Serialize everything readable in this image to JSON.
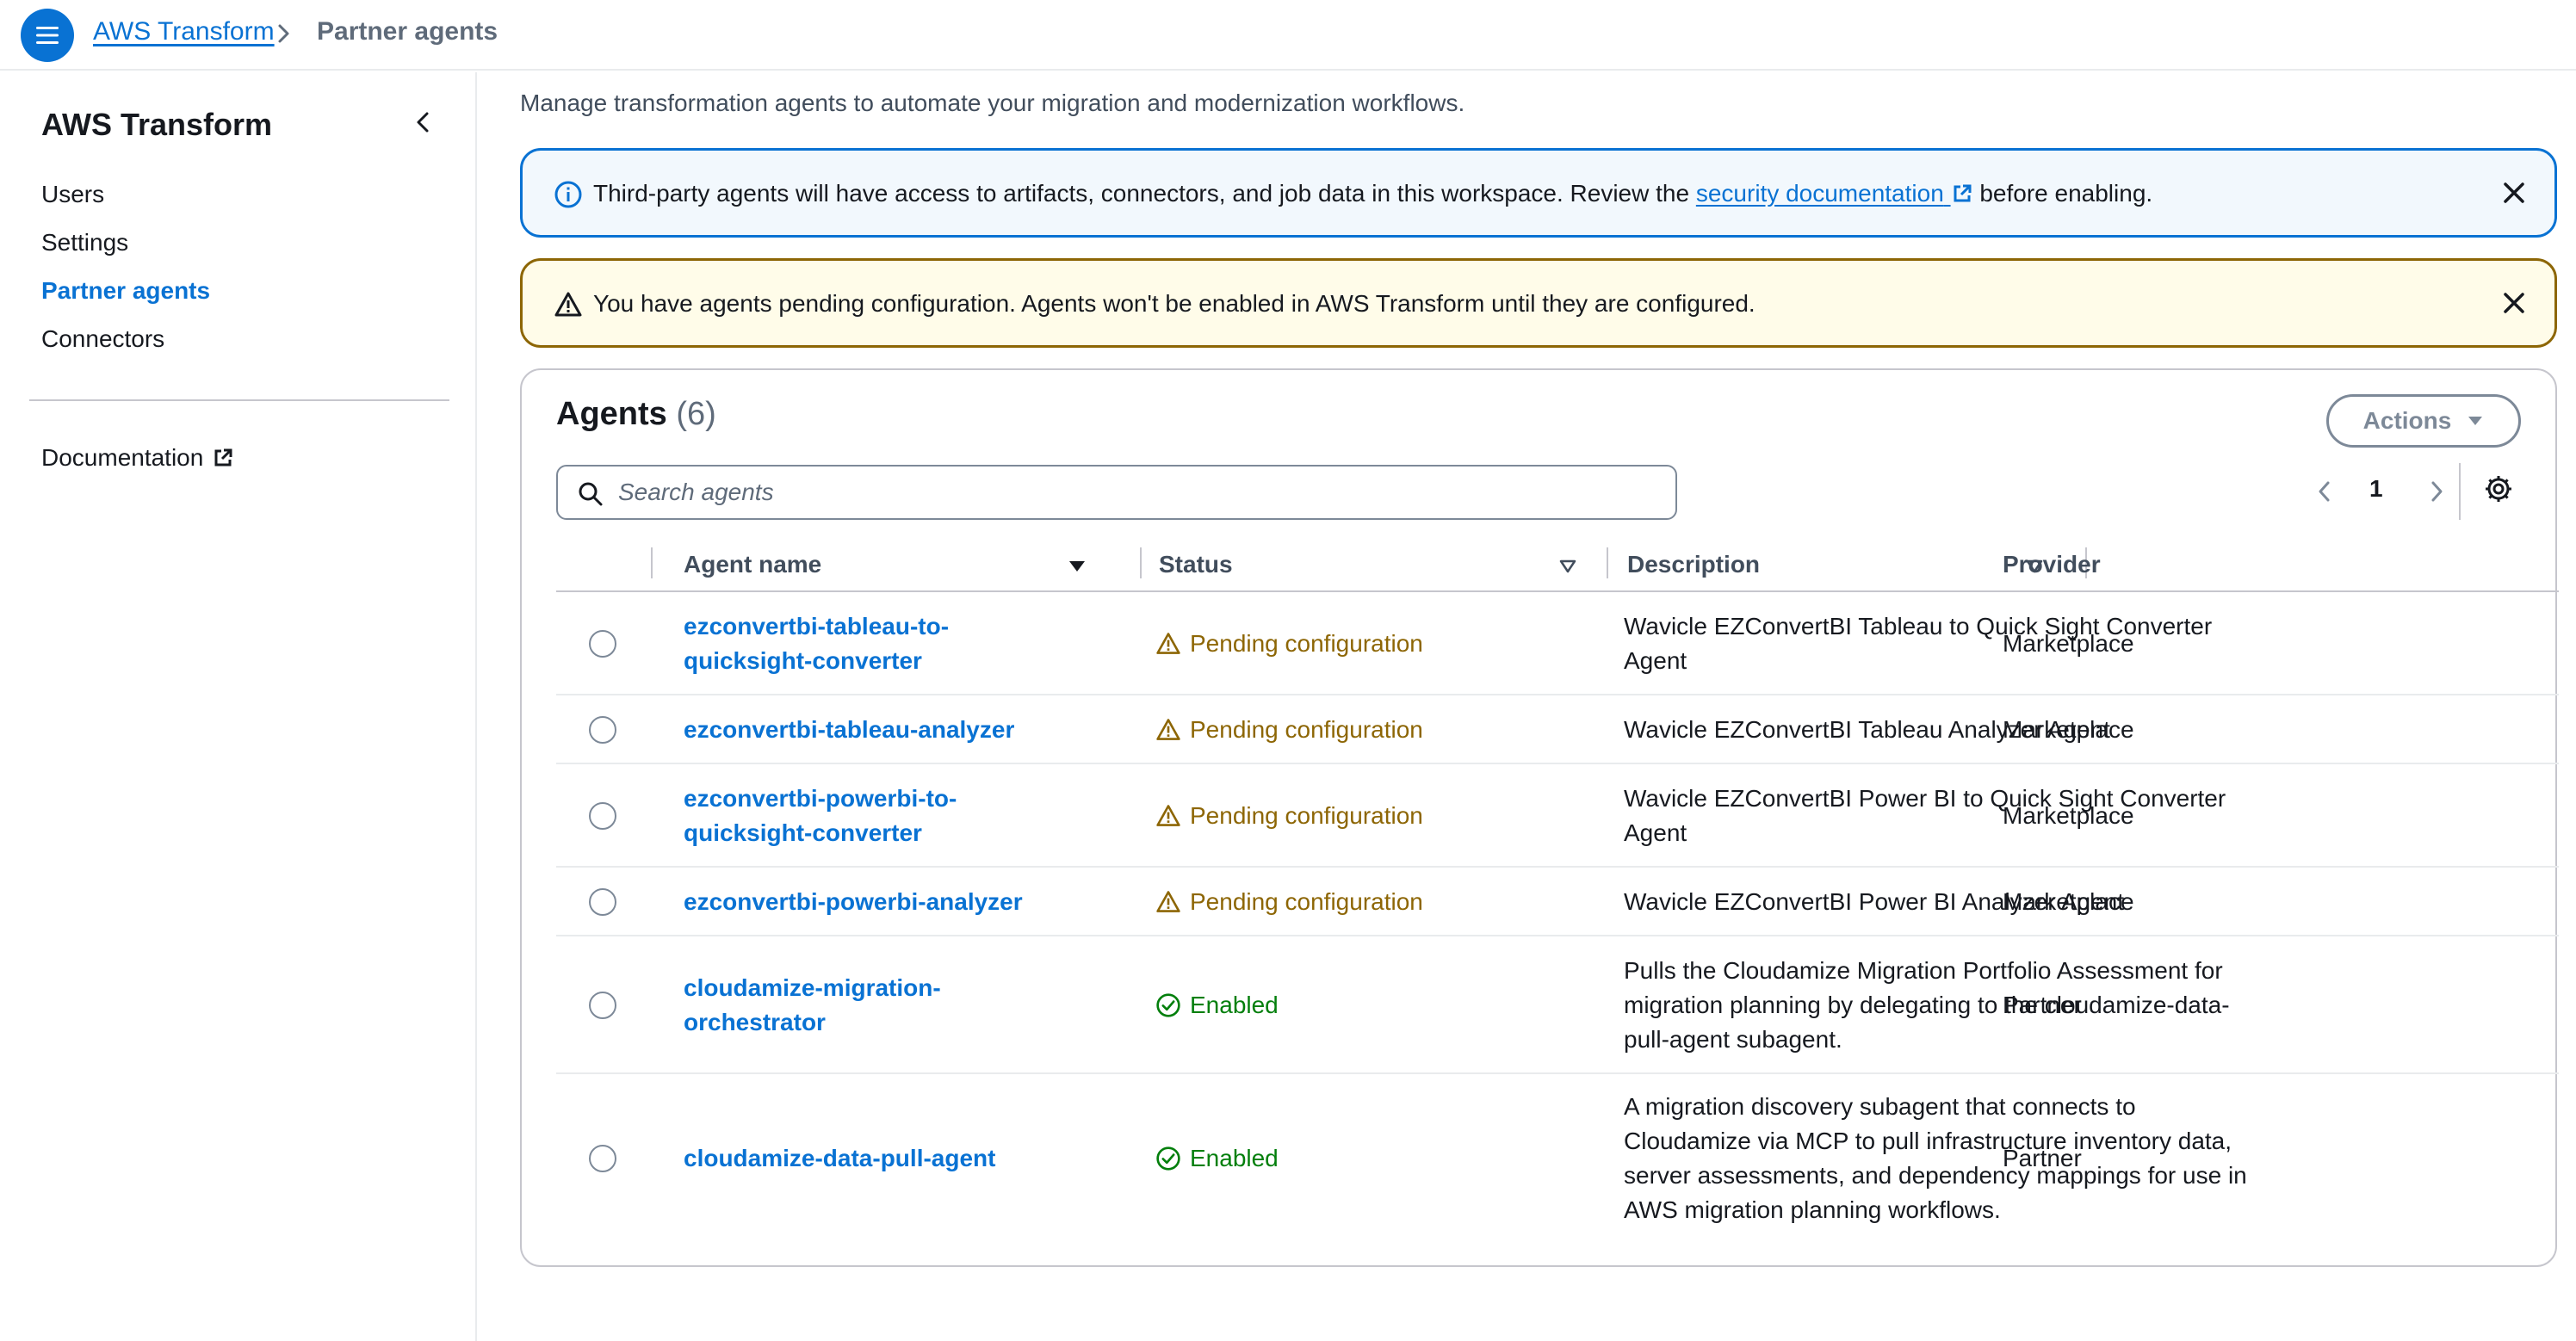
{
  "breadcrumb": {
    "root": "AWS Transform",
    "current": "Partner agents"
  },
  "sidebar": {
    "title": "AWS Transform",
    "items": [
      {
        "label": "Users"
      },
      {
        "label": "Settings"
      },
      {
        "label": "Partner agents"
      },
      {
        "label": "Connectors"
      }
    ],
    "documentation": "Documentation"
  },
  "main": {
    "subtitle": "Manage transformation agents to automate your migration and modernization workflows."
  },
  "alerts": {
    "info_text_before": "Third-party agents will have access to artifacts, connectors, and job data in this workspace. Review the ",
    "info_link": "security documentation",
    "info_text_after": " before enabling.",
    "warning_text": "You have agents pending configuration. Agents won't be enabled in AWS Transform until they are configured."
  },
  "table": {
    "title": "Agents",
    "count": "(6)",
    "actions_label": "Actions",
    "search_placeholder": "Search agents",
    "page": "1",
    "columns": [
      "Agent name",
      "Status",
      "Description",
      "Provider"
    ],
    "rows": [
      {
        "name": "ezconvertbi-tableau-to-quicksight-converter",
        "status": "Pending configuration",
        "status_type": "pending",
        "description": "Wavicle EZConvertBI Tableau to Quick Sight Converter Agent",
        "provider": "Marketplace"
      },
      {
        "name": "ezconvertbi-tableau-analyzer",
        "status": "Pending configuration",
        "status_type": "pending",
        "description": "Wavicle EZConvertBI Tableau Analyzer Agent",
        "provider": "Marketplace"
      },
      {
        "name": "ezconvertbi-powerbi-to-quicksight-converter",
        "status": "Pending configuration",
        "status_type": "pending",
        "description": "Wavicle EZConvertBI Power BI to Quick Sight Converter Agent",
        "provider": "Marketplace"
      },
      {
        "name": "ezconvertbi-powerbi-analyzer",
        "status": "Pending configuration",
        "status_type": "pending",
        "description": "Wavicle EZConvertBI Power BI Analyzer Agent",
        "provider": "Marketplace"
      },
      {
        "name": "cloudamize-migration-orchestrator",
        "status": "Enabled",
        "status_type": "enabled",
        "description": "Pulls the Cloudamize Migration Portfolio Assessment for migration planning by delegating to the cloudamize-data-pull-agent subagent.",
        "provider": "Partner"
      },
      {
        "name": "cloudamize-data-pull-agent",
        "status": "Enabled",
        "status_type": "enabled",
        "description": "A migration discovery subagent that connects to Cloudamize via MCP to pull infrastructure inventory data, server assessments, and dependency mappings for use in AWS migration planning workflows.",
        "provider": "Partner"
      }
    ]
  },
  "colors": {
    "accent": "#0972d3",
    "warning": "#8d6605",
    "success": "#037f0c"
  }
}
